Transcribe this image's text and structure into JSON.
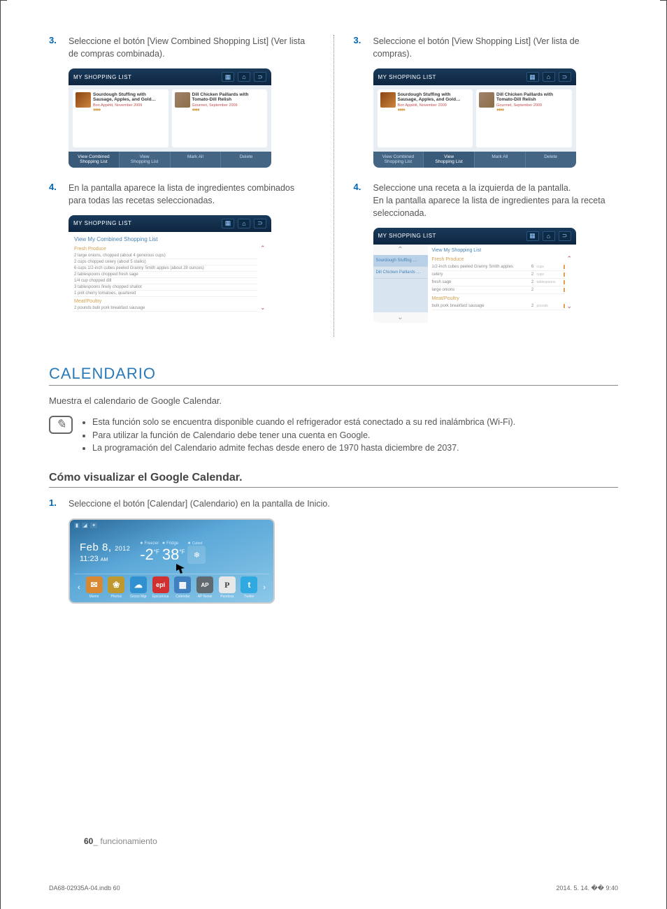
{
  "left": {
    "step3": {
      "num": "3.",
      "text": "Seleccione el botón [View Combined Shopping List] (Ver lista de compras combinada)."
    },
    "step4": {
      "num": "4.",
      "text": "En la pantalla aparece la lista de ingredientes combinados para todas las recetas seleccionadas."
    }
  },
  "right": {
    "step3": {
      "num": "3.",
      "text": "Seleccione el botón [View Shopping List] (Ver lista de compras)."
    },
    "step4": {
      "num": "4.",
      "text1": "Seleccione una receta a la izquierda de la pantalla.",
      "text2": "En la pantalla aparece la lista de ingredientes para la receta seleccionada."
    }
  },
  "ss": {
    "title": "MY SHOPPING LIST",
    "recipe1": {
      "name": "Sourdough Stuffing with Sausage, Apples, and Gold…",
      "src": "Bon Appétit, November 2009",
      "forks": "♦♦♦♦",
      "likes": "4forks"
    },
    "recipe2": {
      "name": "Dill Chicken Paillards with Tomato-Dill Relish",
      "src": "Gourmet, September 2009",
      "forks": "♦♦♦♦",
      "likes": "3forks"
    },
    "btns": {
      "combined": "View Combined\nShopping List",
      "view": "View\nShopping List",
      "mark": "Mark All",
      "delete": "Delete"
    }
  },
  "combined_list": {
    "header": "View My Combined Shopping List",
    "cat1": "Fresh Produce",
    "rows": [
      "2 large onions, chopped (about 4 generous cups)",
      "2 cups chopped celery (about 5 stalks)",
      "6 cups 1/2-inch cubes peeled Granny Smith apples (about 28 ounces)",
      "2 tablespoons chopped fresh sage",
      "1/4 cup chopped dill",
      "3 tablespoons finely chopped shallot",
      "1 pint cherry tomatoes, quartered"
    ],
    "cat2": "Meat/Poultry",
    "row2": "2 pounds bulk pork breakfast sausage"
  },
  "single_list": {
    "header": "View My Shopping List",
    "tab1": "Sourdough Stuffing …",
    "tab2": "Dill Chicken Paillards …",
    "cat1": "Fresh Produce",
    "items": [
      {
        "n": "1/2-inch cubes peeled Granny Smith apples",
        "q": "6",
        "u": "cups"
      },
      {
        "n": "celery",
        "q": "2",
        "u": "cups"
      },
      {
        "n": "fresh sage",
        "q": "2",
        "u": "tablespoons"
      },
      {
        "n": "large onions",
        "q": "2",
        "u": ""
      }
    ],
    "cat2": "Meat/Poultry",
    "meat": {
      "n": "bulk pork breakfast sausage",
      "q": "2",
      "u": "pounds"
    }
  },
  "calendario": {
    "title": "CALENDARIO",
    "intro": "Muestra el calendario de Google Calendar.",
    "notes": [
      "Esta función solo se encuentra disponible cuando el refrigerador está conectado a su red inalámbrica (Wi-Fi).",
      "Para utilizar la función de Calendario debe tener una cuenta en Google.",
      "La programación del Calendario admite fechas desde enero de 1970 hasta diciembre de 2037."
    ],
    "sub": "Cómo visualizar el Google Calendar.",
    "step1": {
      "num": "1.",
      "text": "Seleccione el botón [Calendar] (Calendario) en la pantalla de Inicio."
    }
  },
  "home": {
    "date": "Feb 8,",
    "year": "2012",
    "time": "11:23",
    "ampm": "AM",
    "freezer_lbl": "Freezer",
    "freezer": "-2",
    "f1": "F",
    "fridge_lbl": "Fridge",
    "fridge": "38",
    "f2": "F",
    "cubed": "Cubed",
    "apps": [
      {
        "name": "Memo",
        "color": "#d88830",
        "icon": "✉"
      },
      {
        "name": "Photos",
        "color": "#c09830",
        "icon": "❀"
      },
      {
        "name": "Groce Mgr",
        "color": "#3090d0",
        "icon": "☁"
      },
      {
        "name": "Epicurious",
        "color": "#d03030",
        "icon": "epi"
      },
      {
        "name": "Calendar",
        "color": "#4080c0",
        "icon": "▦"
      },
      {
        "name": "AP News",
        "color": "#606870",
        "icon": "AP"
      },
      {
        "name": "Pandora",
        "color": "#788090",
        "icon": "P"
      },
      {
        "name": "Twitter",
        "color": "#30a8e0",
        "icon": "t"
      }
    ]
  },
  "footer": {
    "page": "60",
    "sect": "_ funcionamiento"
  },
  "meta": {
    "file": "DA68-02935A-04.indb   60",
    "stamp": "2014. 5. 14.   �� 9:40"
  }
}
